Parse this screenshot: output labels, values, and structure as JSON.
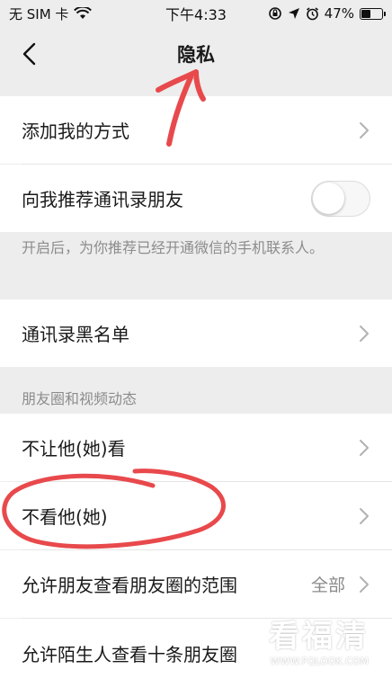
{
  "status": {
    "carrier": "无 SIM 卡",
    "time": "下午4:33",
    "battery": "47%",
    "battery_level": 0.47,
    "icons": [
      "wifi-icon",
      "orientation-lock-icon",
      "location-icon",
      "alarm-icon",
      "battery-icon"
    ]
  },
  "nav": {
    "title": "隐私",
    "back_icon": "chevron-left-icon"
  },
  "rows": {
    "add_methods": "添加我的方式",
    "recommend_contacts": "向我推荐通讯录朋友",
    "recommend_note": "开启后，为你推荐已经开通微信的手机联系人。",
    "blacklist": "通讯录黑名单",
    "section_moments": "朋友圈和视频动态",
    "dont_let_see": "不让他(她)看",
    "dont_see": "不看他(她)",
    "moments_range": "允许朋友查看朋友圈的范围",
    "moments_range_value": "全部",
    "stranger_ten": "允许陌生人查看十条朋友圈"
  },
  "toggle": {
    "recommend_on": false
  },
  "watermark": {
    "big": "看福清",
    "small": "WWW.FQLOOK.COM"
  },
  "colors": {
    "background": "#ededed",
    "row": "#ffffff",
    "annotation": "#e8494c",
    "secondary_text": "#8c8c8c"
  }
}
